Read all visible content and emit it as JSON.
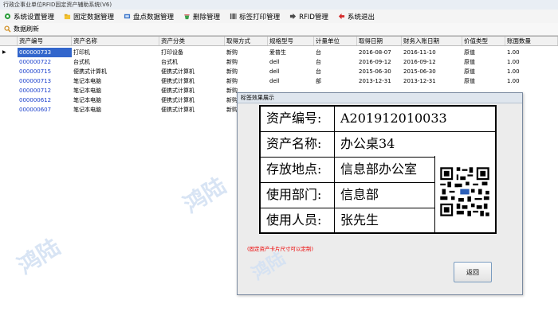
{
  "window": {
    "title": "行政企事业单位RFID固定资产辅助系统(V6)"
  },
  "menu": {
    "items": [
      {
        "label": "系统设置管理",
        "icon": "gear-icon"
      },
      {
        "label": "固定数据管理",
        "icon": "folder-icon"
      },
      {
        "label": "盘点数据管理",
        "icon": "inventory-icon"
      },
      {
        "label": "删除管理",
        "icon": "delete-icon"
      },
      {
        "label": "标签打印管理",
        "icon": "barcode-icon"
      },
      {
        "label": "RFID管理",
        "icon": "rfid-icon"
      },
      {
        "label": "系统退出",
        "icon": "exit-icon"
      }
    ]
  },
  "toolbar": {
    "refresh_label": "数据刷新"
  },
  "table": {
    "columns": [
      "资产编号",
      "资产名称",
      "资产分类",
      "取得方式",
      "规格型号",
      "计量单位",
      "取得日期",
      "财务入账日期",
      "价值类型",
      "账面数量"
    ],
    "rows": [
      [
        "000000733",
        "打印机",
        "打印设备",
        "新购",
        "爱普生",
        "台",
        "2016-08-07",
        "2016-11-10",
        "原值",
        "1.00"
      ],
      [
        "000000722",
        "台式机",
        "台式机",
        "新购",
        "dell",
        "台",
        "2016-09-12",
        "2016-09-12",
        "原值",
        "1.00"
      ],
      [
        "000000715",
        "便携式计算机",
        "便携式计算机",
        "新购",
        "dell",
        "台",
        "2015-06-30",
        "2015-06-30",
        "原值",
        "1.00"
      ],
      [
        "000000713",
        "笔记本电脑",
        "便携式计算机",
        "新购",
        "dell",
        "部",
        "2013-12-31",
        "2013-12-31",
        "原值",
        "1.00"
      ],
      [
        "000000712",
        "笔记本电脑",
        "便携式计算机",
        "新购",
        "",
        "",
        "",
        "",
        "",
        ""
      ],
      [
        "000000612",
        "笔记本电脑",
        "便携式计算机",
        "新购",
        "",
        "",
        "",
        "",
        "",
        ""
      ],
      [
        "000000607",
        "笔记本电脑",
        "便携式计算机",
        "新购",
        "",
        "",
        "",
        "",
        "",
        ""
      ]
    ]
  },
  "watermark": {
    "text": "鸿陆"
  },
  "dialog": {
    "title": "标签效果展示",
    "card": {
      "rows": [
        {
          "label": "资产编号:",
          "value": "A201912010033"
        },
        {
          "label": "资产名称:",
          "value": "办公桌34"
        },
        {
          "label": "存放地点:",
          "value": "信息部办公室"
        },
        {
          "label": "使用部门:",
          "value": "信息部"
        },
        {
          "label": "使用人员:",
          "value": "张先生"
        }
      ]
    },
    "note": "(固定资产卡片尺寸可以定制)",
    "back_label": "返回"
  },
  "colors": {
    "code_text": "#1a3fcc",
    "note_text": "#e00000",
    "watermark": "#d4e2f3"
  }
}
